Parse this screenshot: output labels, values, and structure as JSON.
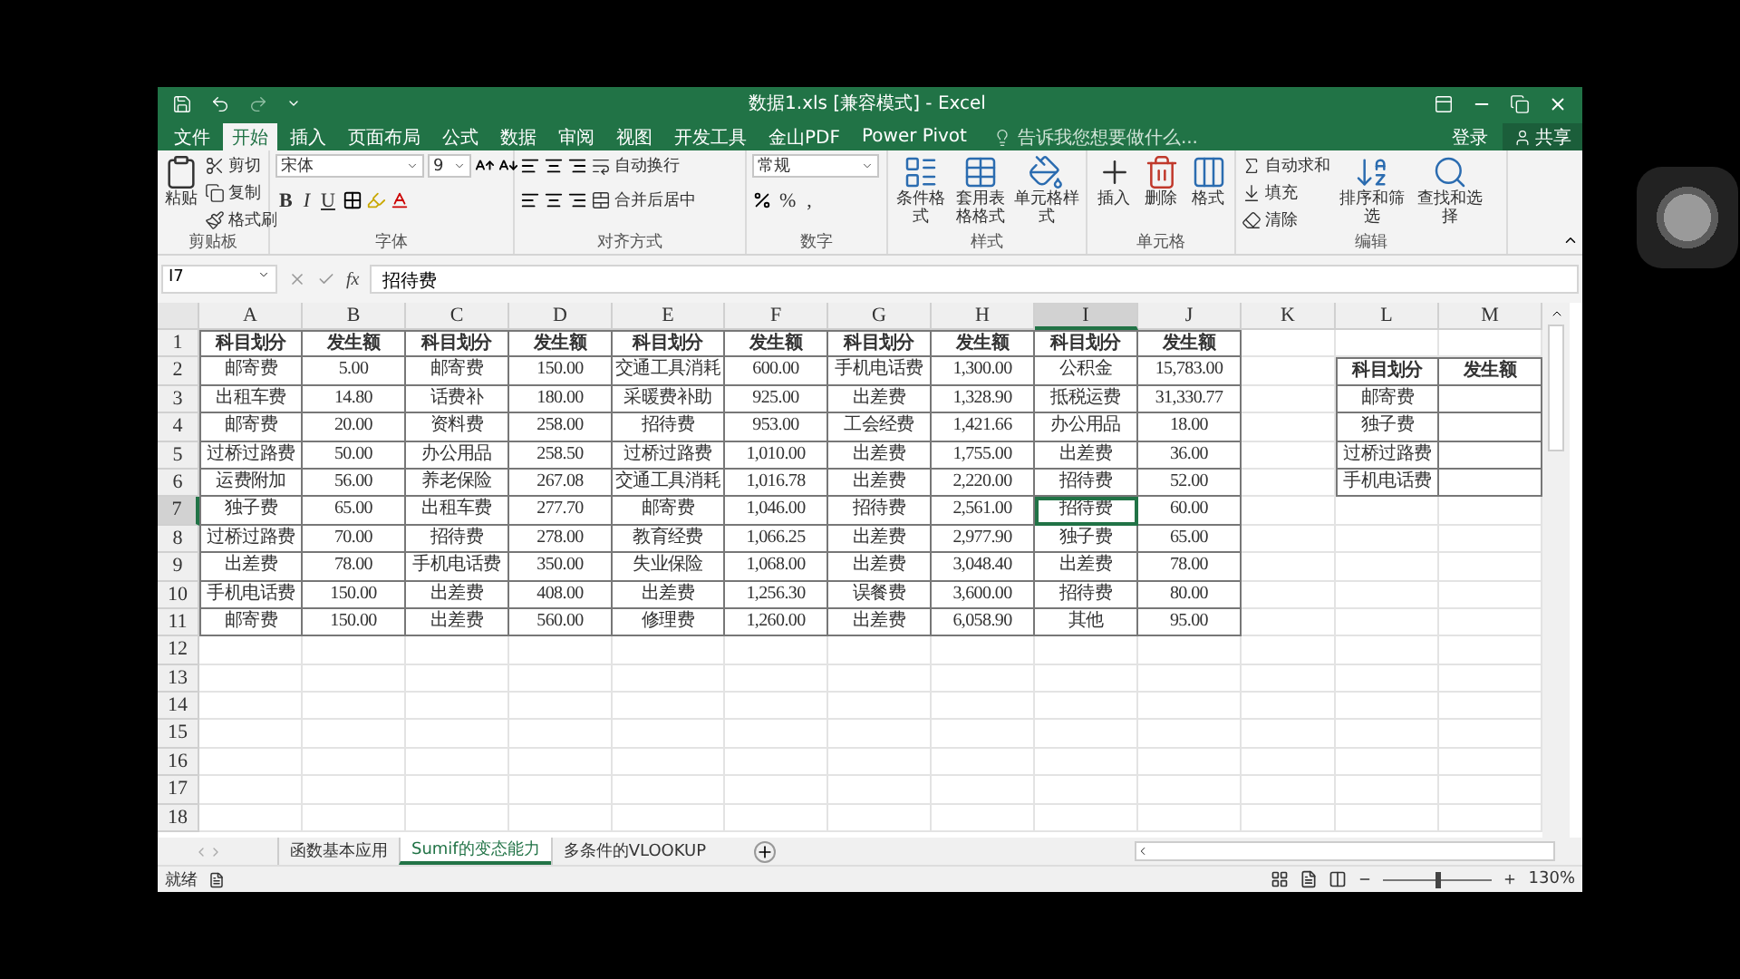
{
  "window": {
    "title": "数据1.xls [兼容模式] - Excel"
  },
  "menu": [
    {
      "label": "文件",
      "selected": false
    },
    {
      "label": "开始",
      "selected": true
    },
    {
      "label": "插入",
      "selected": false
    },
    {
      "label": "页面布局",
      "selected": false
    },
    {
      "label": "公式",
      "selected": false
    },
    {
      "label": "数据",
      "selected": false
    },
    {
      "label": "审阅",
      "selected": false
    },
    {
      "label": "视图",
      "selected": false
    },
    {
      "label": "开发工具",
      "selected": false
    },
    {
      "label": "金山PDF",
      "selected": false
    },
    {
      "label": "Power Pivot",
      "selected": false
    }
  ],
  "tell_me": {
    "placeholder": "告诉我您想要做什么..."
  },
  "account": {
    "sign_in": "登录",
    "share": "共享"
  },
  "ribbon": {
    "clipboard": {
      "label": "剪贴板",
      "paste": "粘贴",
      "cut": "剪切",
      "copy": "复制",
      "format_painter": "格式刷"
    },
    "font": {
      "label": "字体",
      "name": "宋体",
      "size": "9",
      "styles": [
        "B",
        "I",
        "U"
      ]
    },
    "alignment": {
      "label": "对齐方式",
      "wrap": "自动换行",
      "merge": "合并后居中"
    },
    "number": {
      "label": "数字",
      "format": "常规",
      "symbols": [
        "%",
        ","
      ]
    },
    "styles": {
      "label": "样式",
      "buttons": [
        "条件格式",
        "套用表格格式",
        "单元格样式"
      ]
    },
    "cells": {
      "label": "单元格",
      "buttons": [
        "插入",
        "删除",
        "格式"
      ]
    },
    "editing": {
      "label": "编辑",
      "small": [
        "自动求和",
        "填充",
        "清除"
      ],
      "large": [
        "排序和筛选",
        "查找和选择"
      ]
    }
  },
  "formula_bar": {
    "name_box": "I7",
    "function_label": "fx",
    "formula": "招待费"
  },
  "sheet": {
    "columns": [
      {
        "label": "A",
        "selected": false
      },
      {
        "label": "B",
        "selected": false
      },
      {
        "label": "C",
        "selected": false
      },
      {
        "label": "D",
        "selected": false
      },
      {
        "label": "E",
        "selected": false
      },
      {
        "label": "F",
        "selected": false
      },
      {
        "label": "G",
        "selected": false
      },
      {
        "label": "H",
        "selected": false
      },
      {
        "label": "I",
        "selected": true
      },
      {
        "label": "J",
        "selected": false
      },
      {
        "label": "K",
        "selected": false
      },
      {
        "label": "L",
        "selected": false
      },
      {
        "label": "M",
        "selected": false
      }
    ],
    "rows": [
      {
        "label": "1",
        "selected": false
      },
      {
        "label": "2",
        "selected": false
      },
      {
        "label": "3",
        "selected": false
      },
      {
        "label": "4",
        "selected": false
      },
      {
        "label": "5",
        "selected": false
      },
      {
        "label": "6",
        "selected": false
      },
      {
        "label": "7",
        "selected": true
      },
      {
        "label": "8",
        "selected": false
      },
      {
        "label": "9",
        "selected": false
      },
      {
        "label": "10",
        "selected": false
      },
      {
        "label": "11",
        "selected": false
      },
      {
        "label": "12",
        "selected": false
      },
      {
        "label": "13",
        "selected": false
      },
      {
        "label": "14",
        "selected": false
      },
      {
        "label": "15",
        "selected": false
      },
      {
        "label": "16",
        "selected": false
      },
      {
        "label": "17",
        "selected": false
      },
      {
        "label": "18",
        "selected": false
      }
    ]
  },
  "table": {
    "header": [
      "科目划分",
      "发生额",
      "科目划分",
      "发生额",
      "科目划分",
      "发生额",
      "科目划分",
      "发生额",
      "科目划分",
      "发生额"
    ],
    "rows": [
      [
        "邮寄费",
        "5.00",
        "邮寄费",
        "150.00",
        "交通工具消耗",
        "600.00",
        "手机电话费",
        "1,300.00",
        "公积金",
        "15,783.00"
      ],
      [
        "出租车费",
        "14.80",
        "话费补",
        "180.00",
        "采暖费补助",
        "925.00",
        "出差费",
        "1,328.90",
        "抵税运费",
        "31,330.77"
      ],
      [
        "邮寄费",
        "20.00",
        "资料费",
        "258.00",
        "招待费",
        "953.00",
        "工会经费",
        "1,421.66",
        "办公用品",
        "18.00"
      ],
      [
        "过桥过路费",
        "50.00",
        "办公用品",
        "258.50",
        "过桥过路费",
        "1,010.00",
        "出差费",
        "1,755.00",
        "出差费",
        "36.00"
      ],
      [
        "运费附加",
        "56.00",
        "养老保险",
        "267.08",
        "交通工具消耗",
        "1,016.78",
        "出差费",
        "2,220.00",
        "招待费",
        "52.00"
      ],
      [
        "独子费",
        "65.00",
        "出租车费",
        "277.70",
        "邮寄费",
        "1,046.00",
        "招待费",
        "2,561.00",
        "招待费",
        "60.00"
      ],
      [
        "过桥过路费",
        "70.00",
        "招待费",
        "278.00",
        "教育经费",
        "1,066.25",
        "出差费",
        "2,977.90",
        "独子费",
        "65.00"
      ],
      [
        "出差费",
        "78.00",
        "手机电话费",
        "350.00",
        "失业保险",
        "1,068.00",
        "出差费",
        "3,048.40",
        "出差费",
        "78.00"
      ],
      [
        "手机电话费",
        "150.00",
        "出差费",
        "408.00",
        "出差费",
        "1,256.30",
        "误餐费",
        "3,600.00",
        "招待费",
        "80.00"
      ],
      [
        "邮寄费",
        "150.00",
        "出差费",
        "560.00",
        "修理费",
        "1,260.00",
        "出差费",
        "6,058.90",
        "其他",
        "95.00"
      ]
    ]
  },
  "summary_table": {
    "header": [
      "科目划分",
      "发生额"
    ],
    "rows": [
      "邮寄费",
      "独子费",
      "过桥过路费",
      "手机电话费"
    ]
  },
  "sheet_tabs": [
    {
      "label": "函数基本应用",
      "selected": false
    },
    {
      "label": "Sumif的变态能力",
      "selected": true
    },
    {
      "label": "多条件的VLOOKUP",
      "selected": false
    }
  ],
  "status_bar": {
    "status": "就绪",
    "zoom": {
      "level": 0.5,
      "reading": "130%"
    }
  }
}
